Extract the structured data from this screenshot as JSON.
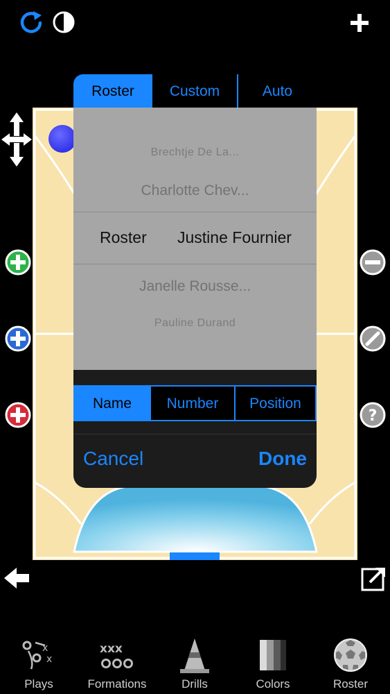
{
  "toolbar": {
    "refresh_icon": "refresh-icon",
    "contrast_icon": "contrast-icon",
    "add_icon": "plus-icon"
  },
  "mode_tabs": [
    {
      "label": "Roster",
      "selected": true
    },
    {
      "label": "Custom",
      "selected": false
    },
    {
      "label": "Auto",
      "selected": false
    }
  ],
  "picker": {
    "column_label": "Roster",
    "selected": "Justine Fournier",
    "above": [
      "Brechtje De La...",
      "Charlotte Chev..."
    ],
    "below": [
      "Janelle Rousse...",
      "Pauline Durand"
    ]
  },
  "sort_tabs": [
    {
      "label": "Name",
      "selected": true
    },
    {
      "label": "Number",
      "selected": false
    },
    {
      "label": "Position",
      "selected": false
    }
  ],
  "dialog": {
    "cancel_label": "Cancel",
    "done_label": "Done"
  },
  "side_left": [
    "add-green-icon",
    "add-blue-icon",
    "add-red-icon"
  ],
  "side_right": [
    "minus-icon",
    "edit-icon",
    "help-icon"
  ],
  "colors": {
    "accent": "#1a86ff",
    "court": "#f8e3ad",
    "picker_bg": "#a6a6a6"
  },
  "nav": [
    {
      "label": "Plays",
      "icon": "plays-icon"
    },
    {
      "label": "Formations",
      "icon": "formations-icon"
    },
    {
      "label": "Drills",
      "icon": "cone-icon"
    },
    {
      "label": "Colors",
      "icon": "colors-icon"
    },
    {
      "label": "Roster",
      "icon": "ball-icon"
    }
  ]
}
